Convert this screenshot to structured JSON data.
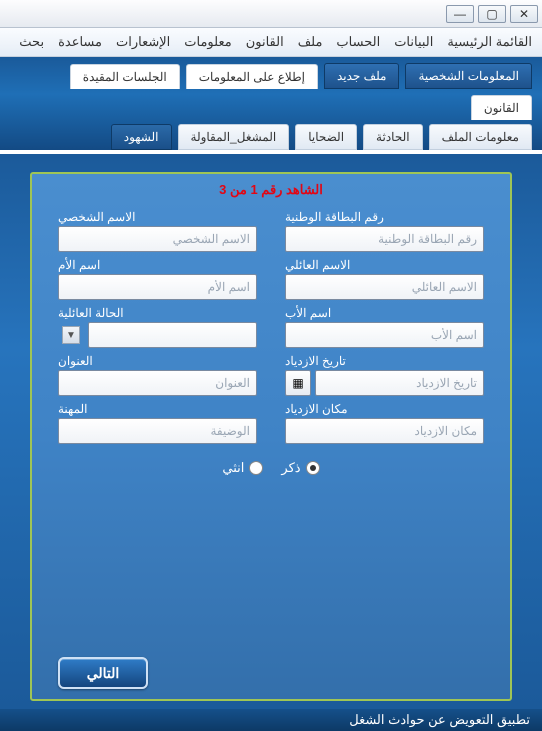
{
  "window_controls": {
    "min": "—",
    "max": "▢",
    "close": "✕"
  },
  "menubar": [
    "القائمة الرئيسية",
    "البيانات",
    "الحساب",
    "ملف",
    "القانون",
    "معلومات",
    "الإشعارات",
    "مساعدة",
    "بحث"
  ],
  "tabs_main": [
    {
      "label": "المعلومات الشخصية",
      "active": true,
      "style": "dark"
    },
    {
      "label": "ملف جديد",
      "active": true,
      "style": "dark"
    },
    {
      "label": "إطلاع على المعلومات",
      "style": "light"
    },
    {
      "label": "الجلسات المقيدة",
      "style": "light"
    },
    {
      "label": "القانون",
      "style": "light"
    }
  ],
  "tabs_sub": [
    {
      "label": "معلومات الملف",
      "style": "sub"
    },
    {
      "label": "الحادثة",
      "style": "sub"
    },
    {
      "label": "الضحايا",
      "style": "sub"
    },
    {
      "label": "المشغل_المقاولة",
      "style": "sub"
    },
    {
      "label": "الشهود",
      "style": "sub-active"
    }
  ],
  "card": {
    "title": "الشاهد رقم 1 من 3",
    "fields": {
      "national_id": {
        "label": "رقم البطاقة الوطنية",
        "placeholder": "رقم البطاقة الوطنية"
      },
      "personal_name": {
        "label": "الاسم الشخصي",
        "placeholder": "الاسم الشخصي"
      },
      "family_name": {
        "label": "الاسم العائلي",
        "placeholder": "الاسم العائلي"
      },
      "mother_name": {
        "label": "اسم الأم",
        "placeholder": "اسم الأم"
      },
      "father_name": {
        "label": "اسم الأب",
        "placeholder": "اسم الأب"
      },
      "marital_status": {
        "label": "الحالة العائلية",
        "placeholder": ""
      },
      "birth_date": {
        "label": "تاريخ الازدياد",
        "placeholder": "تاريخ الازدياد"
      },
      "address": {
        "label": "العنوان",
        "placeholder": "العنوان"
      },
      "birth_place": {
        "label": "مكان الازدياد",
        "placeholder": "مكان الازدياد"
      },
      "profession": {
        "label": "المهنة",
        "placeholder": "الوضيفة"
      }
    },
    "gender": {
      "male": "ذكر",
      "female": "انثي"
    },
    "next": "التالي"
  },
  "footer": "تطبيق التعويض عن حوادث الشغل"
}
